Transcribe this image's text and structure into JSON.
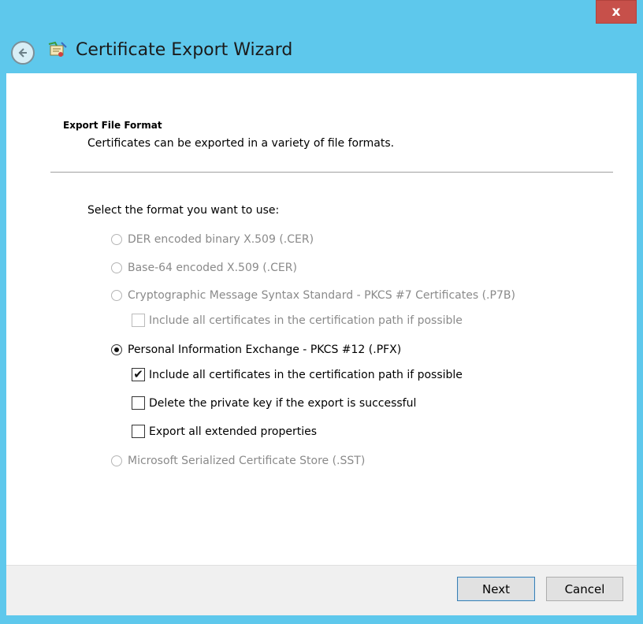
{
  "window": {
    "title": "Certificate Export Wizard",
    "close_label": "x"
  },
  "icons": {
    "back": "back-arrow-icon",
    "wizard": "certificate-wizard-icon",
    "close": "close-icon"
  },
  "section": {
    "heading": "Export File Format",
    "description": "Certificates can be exported in a variety of file formats."
  },
  "prompt": "Select the format you want to use:",
  "options": [
    {
      "label": "DER encoded binary X.509 (.CER)",
      "selected": false,
      "enabled": false
    },
    {
      "label": "Base-64 encoded X.509 (.CER)",
      "selected": false,
      "enabled": false
    },
    {
      "label": "Cryptographic Message Syntax Standard - PKCS #7 Certificates (.P7B)",
      "selected": false,
      "enabled": false
    },
    {
      "label": "Personal Information Exchange - PKCS #12 (.PFX)",
      "selected": true,
      "enabled": true
    },
    {
      "label": "Microsoft Serialized Certificate Store (.SST)",
      "selected": false,
      "enabled": false
    }
  ],
  "p7b_checkboxes": [
    {
      "label": "Include all certificates in the certification path if possible",
      "checked": false,
      "enabled": false
    }
  ],
  "pfx_checkboxes": [
    {
      "label": "Include all certificates in the certification path if possible",
      "checked": true,
      "enabled": true
    },
    {
      "label": "Delete the private key if the export is successful",
      "checked": false,
      "enabled": true
    },
    {
      "label": "Export all extended properties",
      "checked": false,
      "enabled": true
    }
  ],
  "buttons": {
    "next": "Next",
    "cancel": "Cancel"
  },
  "colors": {
    "titlebar": "#5ec8ec",
    "close": "#c7504a",
    "disabled_text": "#8a8a8a"
  }
}
